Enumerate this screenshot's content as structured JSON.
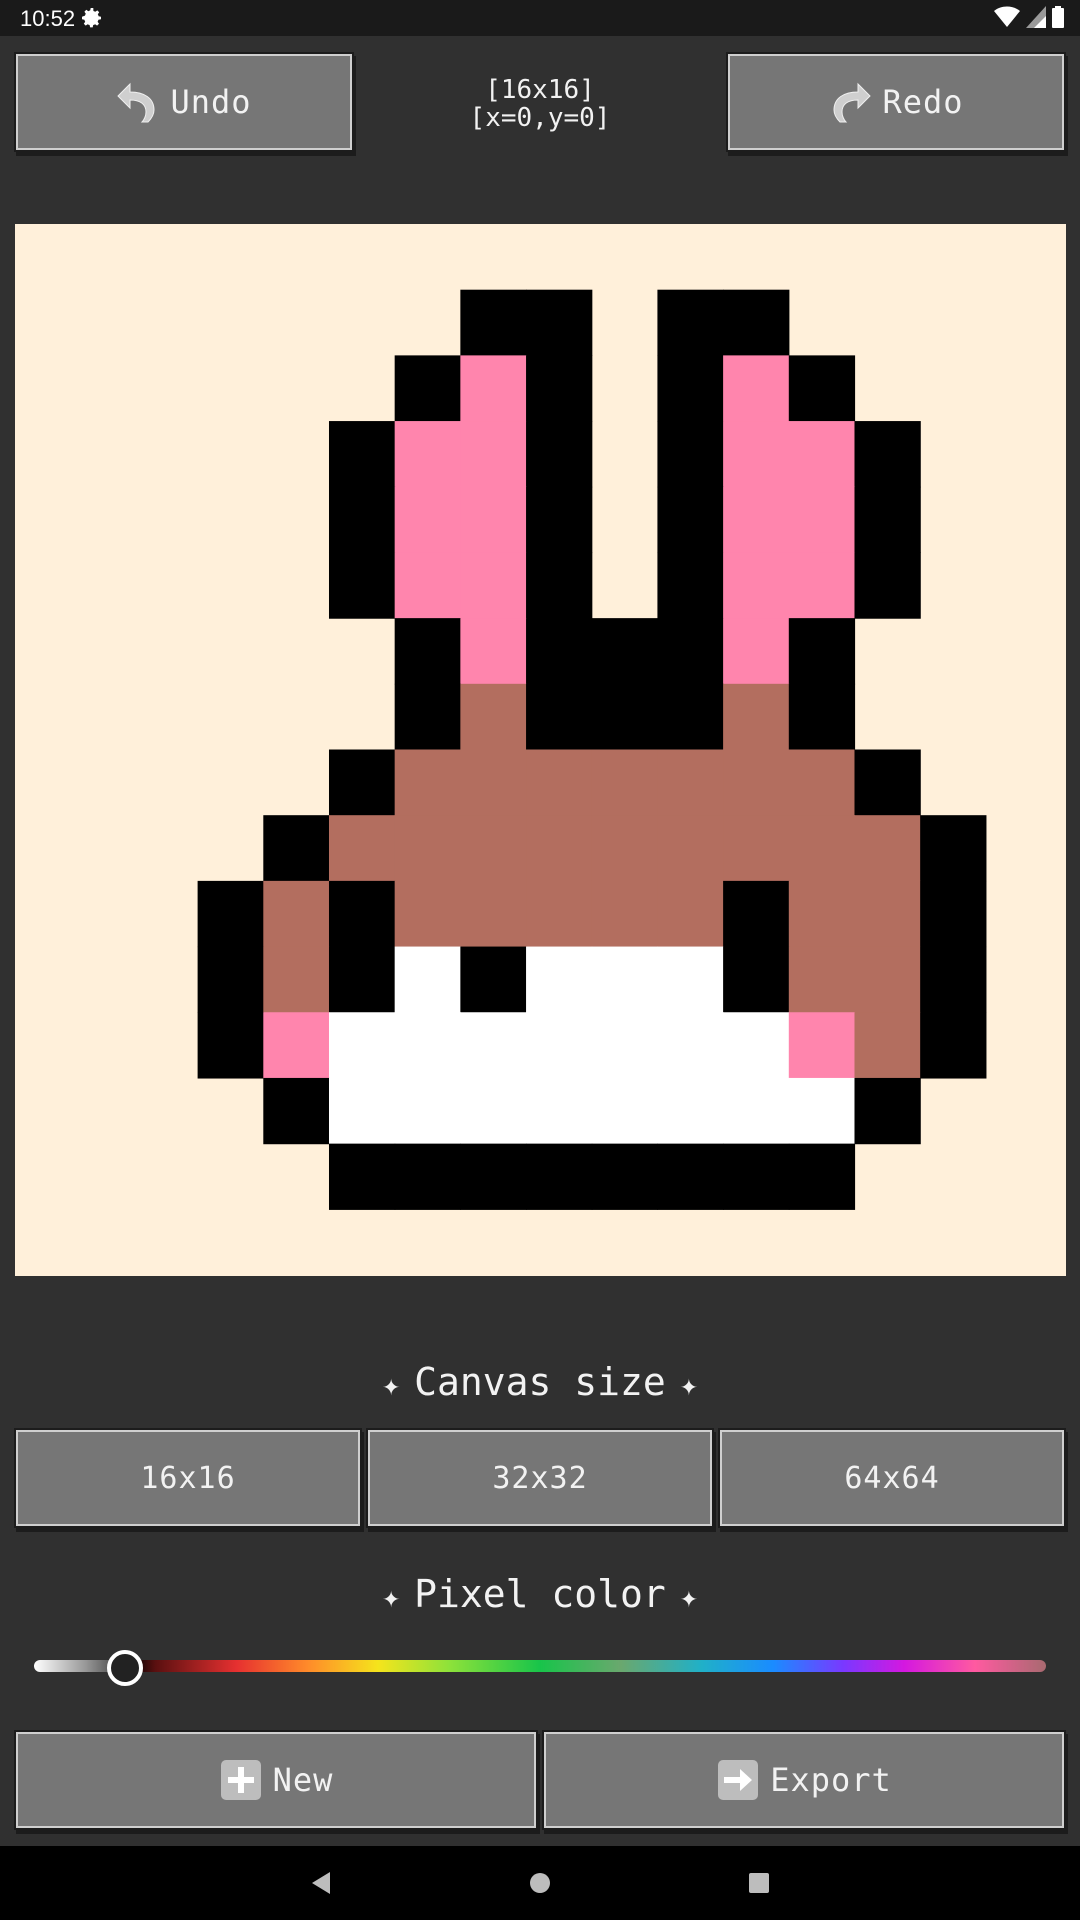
{
  "status_bar": {
    "time": "10:52"
  },
  "toolbar": {
    "undo_label": "Undo",
    "redo_label": "Redo",
    "canvas_info_size": "[16x16]",
    "canvas_info_cursor": "[x=0,y=0]"
  },
  "canvas": {
    "grid_size": 16,
    "background": "#fff0da",
    "palette": {
      ".": "transparent",
      "K": "#000000",
      "P": "#ff85ad",
      "B": "#b36e5f",
      "W": "#ffffff"
    },
    "rows": [
      "................",
      "....KK.KK.......",
      "...KPK.KPK......",
      "..KPPK.KPPK.....",
      "..KPPK.KPPK.....",
      "..KPPK.KPPK.....",
      "...KPKKKPK......",
      "...KBKKKBK......",
      "..KBBBBBBBK.....",
      ".KBBBBBBBBBK....",
      "KBKBBBBBKBBK....",
      "KBKWKWWWKBBK....",
      "KPWWWWWWWPBK....",
      ".KWWWWWWWWK.....",
      "..KKKKKKKK......",
      "................"
    ]
  },
  "canvas_size_section": {
    "title": "Canvas size",
    "options": [
      "16x16",
      "32x32",
      "64x64"
    ]
  },
  "pixel_color_section": {
    "title": "Pixel color",
    "slider_value": 0.09
  },
  "actions": {
    "new_label": "New",
    "export_label": "Export"
  },
  "icons": {
    "settings": "gear-icon",
    "undo": "undo-arrow-icon",
    "redo": "redo-arrow-icon",
    "new": "plus-icon",
    "export": "export-arrow-icon",
    "spark": "sparkle-icon"
  }
}
